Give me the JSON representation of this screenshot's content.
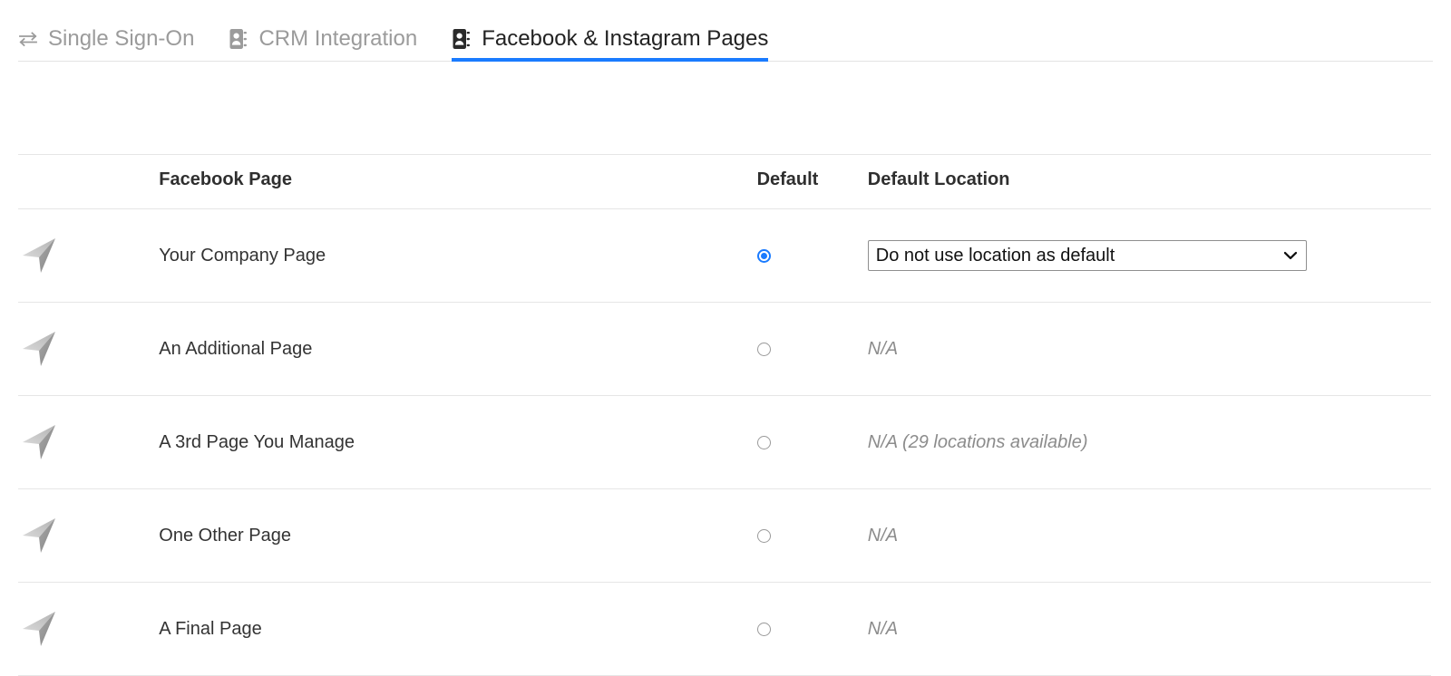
{
  "theme": {
    "accent": "#1a7bff",
    "text": "#333333",
    "muted": "#8c8c8c",
    "inactive_tab": "#9b9b9b",
    "divider": "#e6e6e6"
  },
  "tabs": [
    {
      "label": "Single Sign-On",
      "icon": "exchange-arrows-icon",
      "active": false
    },
    {
      "label": "CRM Integration",
      "icon": "address-book-icon",
      "active": false
    },
    {
      "label": "Facebook & Instagram Pages",
      "icon": "address-book-icon",
      "active": true
    }
  ],
  "table": {
    "headers": {
      "avatar": "",
      "page": "Facebook Page",
      "default": "Default",
      "default_location": "Default Location"
    },
    "rows": [
      {
        "avatar_icon": "navigation-arrow-avatar",
        "name": "Your Company Page",
        "default_selected": true,
        "location_type": "select",
        "location_value": "Do not use location as default",
        "location_options": [
          "Do not use location as default"
        ]
      },
      {
        "avatar_icon": "navigation-arrow-avatar",
        "name": "An Additional Page",
        "default_selected": false,
        "location_type": "text",
        "location_value": "N/A"
      },
      {
        "avatar_icon": "navigation-arrow-avatar",
        "name": "A 3rd Page You Manage",
        "default_selected": false,
        "location_type": "text",
        "location_value": "N/A (29 locations available)"
      },
      {
        "avatar_icon": "navigation-arrow-avatar",
        "name": "One Other Page",
        "default_selected": false,
        "location_type": "text",
        "location_value": "N/A"
      },
      {
        "avatar_icon": "navigation-arrow-avatar",
        "name": "A Final Page",
        "default_selected": false,
        "location_type": "text",
        "location_value": "N/A"
      }
    ]
  }
}
